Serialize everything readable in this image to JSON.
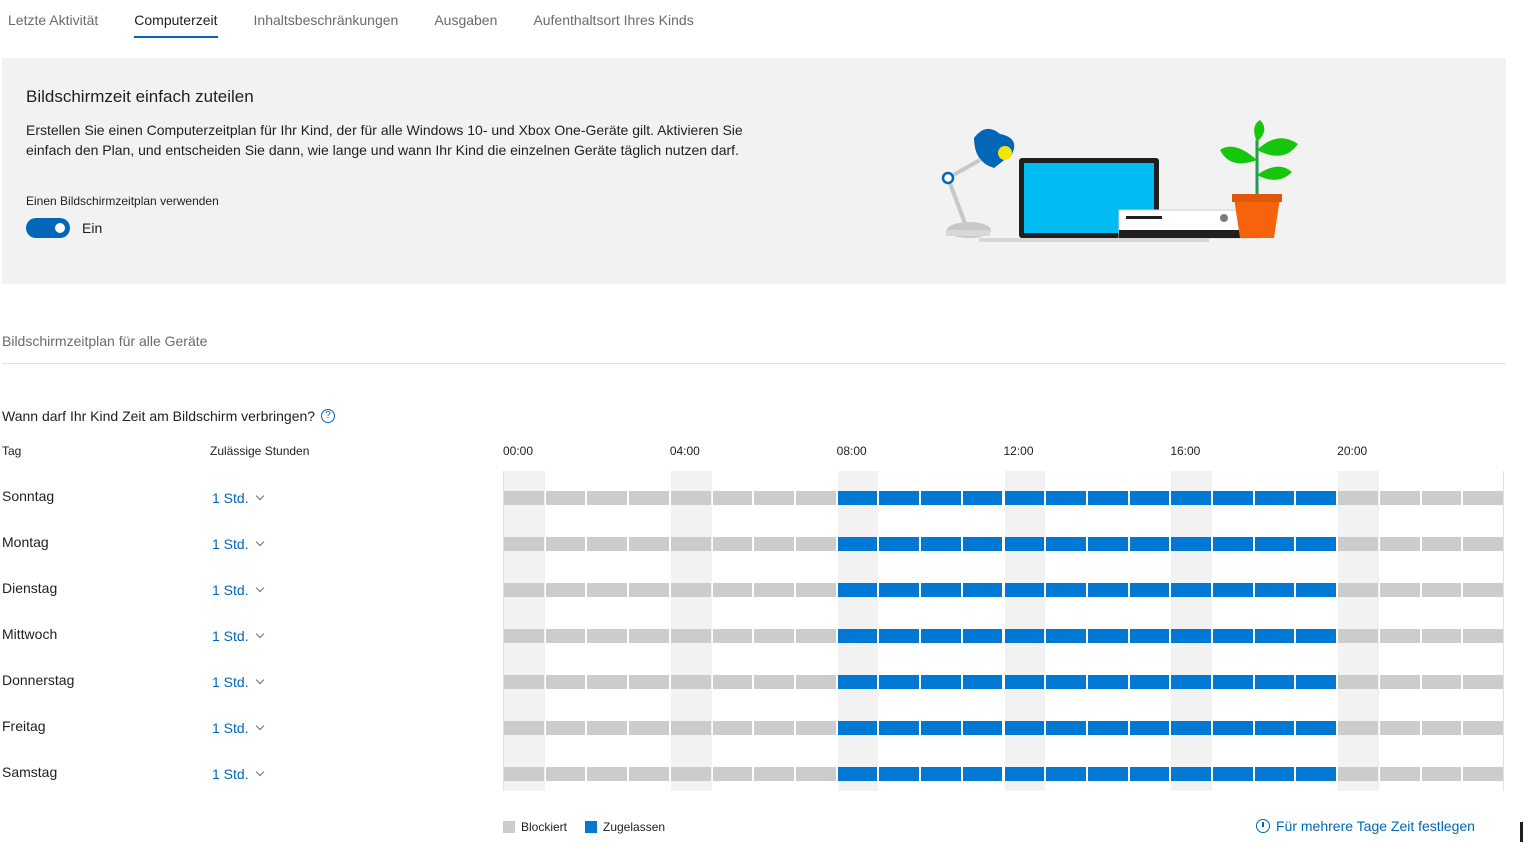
{
  "tabs": [
    {
      "label": "Letzte Aktivität",
      "active": false
    },
    {
      "label": "Computerzeit",
      "active": true
    },
    {
      "label": "Inhaltsbeschränkungen",
      "active": false
    },
    {
      "label": "Ausgaben",
      "active": false
    },
    {
      "label": "Aufenthaltsort Ihres Kinds",
      "active": false
    }
  ],
  "hero": {
    "title": "Bildschirmzeit einfach zuteilen",
    "description": "Erstellen Sie einen Computerzeitplan für Ihr Kind, der für alle Windows 10- und Xbox One-Geräte gilt. Aktivieren Sie einfach den Plan, und entscheiden Sie dann, wie lange und wann Ihr Kind die einzelnen Geräte täglich nutzen darf.",
    "toggle_label": "Einen Bildschirmzeitplan verwenden",
    "toggle_state": "Ein",
    "toggle_on": true
  },
  "schedule": {
    "section_title": "Bildschirmzeitplan für alle Geräte",
    "question": "Wann darf Ihr Kind Zeit am Bildschirm verbringen?",
    "help_icon": "help-circle-icon",
    "col_day": "Tag",
    "col_hours": "Zulässige Stunden",
    "time_labels": [
      "00:00",
      "04:00",
      "08:00",
      "12:00",
      "16:00",
      "20:00"
    ],
    "days": [
      {
        "name": "Sonntag",
        "hours": "1 Std.",
        "allowed_from": 8,
        "allowed_to": 20
      },
      {
        "name": "Montag",
        "hours": "1 Std.",
        "allowed_from": 8,
        "allowed_to": 20
      },
      {
        "name": "Dienstag",
        "hours": "1 Std.",
        "allowed_from": 8,
        "allowed_to": 20
      },
      {
        "name": "Mittwoch",
        "hours": "1 Std.",
        "allowed_from": 8,
        "allowed_to": 20
      },
      {
        "name": "Donnerstag",
        "hours": "1 Std.",
        "allowed_from": 8,
        "allowed_to": 20
      },
      {
        "name": "Freitag",
        "hours": "1 Std.",
        "allowed_from": 8,
        "allowed_to": 20
      },
      {
        "name": "Samstag",
        "hours": "1 Std.",
        "allowed_from": 8,
        "allowed_to": 20
      }
    ],
    "legend": {
      "blocked": "Blockiert",
      "allowed": "Zugelassen"
    },
    "multi_day_link": "Für mehrere Tage Zeit festlegen"
  },
  "colors": {
    "accent": "#0067b8",
    "allowed": "#0078d4",
    "blocked": "#cccccc",
    "panel": "#f2f2f2"
  }
}
